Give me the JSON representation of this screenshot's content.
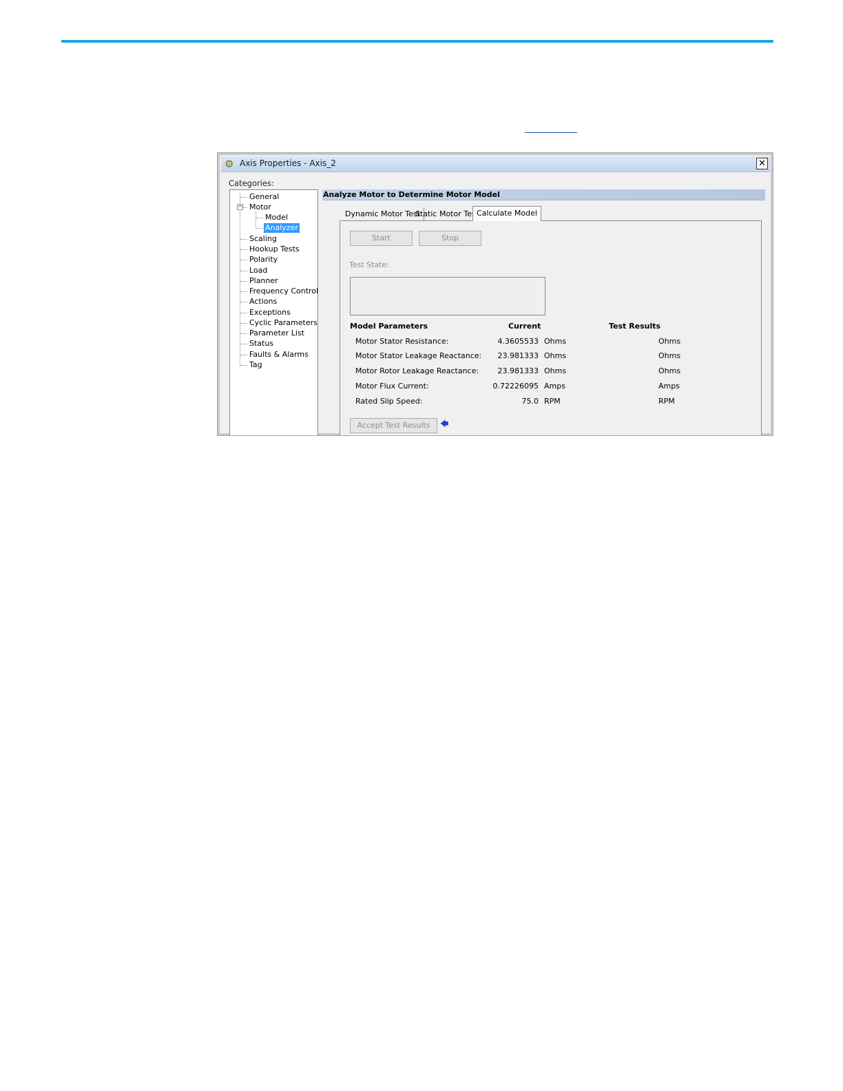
{
  "dialog": {
    "title": "Axis Properties - Axis_2",
    "close_glyph": "✕",
    "categories_label": "Categories:"
  },
  "tree": {
    "items": [
      {
        "label": "General"
      },
      {
        "label": "Motor",
        "expander": "−"
      },
      {
        "label": "Model"
      },
      {
        "label": "Analyzer",
        "selected": true
      },
      {
        "label": "Scaling"
      },
      {
        "label": "Hookup Tests"
      },
      {
        "label": "Polarity"
      },
      {
        "label": "Load"
      },
      {
        "label": "Planner"
      },
      {
        "label": "Frequency Control"
      },
      {
        "label": "Actions"
      },
      {
        "label": "Exceptions"
      },
      {
        "label": "Cyclic Parameters"
      },
      {
        "label": "Parameter List"
      },
      {
        "label": "Status"
      },
      {
        "label": "Faults & Alarms"
      },
      {
        "label": "Tag"
      }
    ]
  },
  "panel": {
    "header": "Analyze Motor to Determine Motor Model",
    "tabs": [
      {
        "label": "Dynamic Motor Test"
      },
      {
        "label": "Static Motor Test"
      },
      {
        "label": "Calculate Model",
        "active": true
      }
    ],
    "start_label": "Start",
    "stop_label": "Stop",
    "test_state_label": "Test State:",
    "columns": {
      "params": "Model Parameters",
      "current": "Current",
      "results": "Test Results"
    },
    "rows": [
      {
        "label": "Motor Stator Resistance:",
        "value": "4.3605533",
        "unit": "Ohms",
        "result_unit": "Ohms"
      },
      {
        "label": "Motor Stator Leakage Reactance:",
        "value": "23.981333",
        "unit": "Ohms",
        "result_unit": "Ohms"
      },
      {
        "label": "Motor Rotor Leakage Reactance:",
        "value": "23.981333",
        "unit": "Ohms",
        "result_unit": "Ohms"
      },
      {
        "label": "Motor Flux Current:",
        "value": "0.72226095",
        "unit": "Amps",
        "result_unit": "Amps"
      },
      {
        "label": "Rated Slip Speed:",
        "value": "75.0",
        "unit": "RPM",
        "result_unit": "RPM"
      }
    ],
    "accept_label": "Accept Test Results",
    "accept_arrow": "🡄"
  },
  "colors": {
    "accent_rule": "#13a8dc",
    "selection": "#3399ff"
  }
}
